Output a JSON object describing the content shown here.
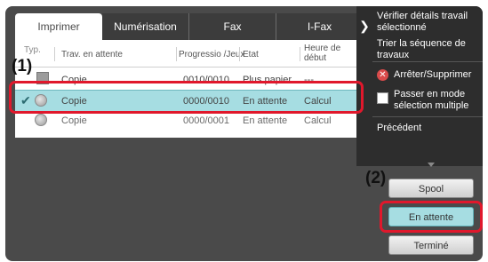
{
  "tabs": [
    {
      "label": "Imprimer",
      "active": true
    },
    {
      "label": "Numérisation",
      "active": false
    },
    {
      "label": "Fax",
      "active": false
    },
    {
      "label": "I-Fax",
      "active": false
    }
  ],
  "table": {
    "headers": {
      "type": "Typ.",
      "job": "Trav. en attente",
      "progress": "Progressio /Jeux",
      "status": "Etat",
      "start": "Heure de début"
    },
    "rows": [
      {
        "job": "Copie",
        "progress": "0010/0010",
        "status": "Plus papier",
        "start": "---"
      },
      {
        "job": "Copie",
        "progress": "0000/0010",
        "status": "En attente",
        "start": "Calcul"
      },
      {
        "job": "Copie",
        "progress": "0000/0001",
        "status": "En attente",
        "start": "Calcul"
      }
    ]
  },
  "side_menu": {
    "verify": "Vérifier détails travail sélectionné",
    "sort": "Trier la séquence de travaux",
    "stop": "Arrêter/Supprimer",
    "multi": "Passer en mode sélection multiple",
    "previous": "Précédent"
  },
  "buttons": {
    "spool": "Spool",
    "waiting": "En attente",
    "done": "Terminé"
  },
  "callouts": {
    "one": "(1)",
    "two": "(2)"
  },
  "colors": {
    "highlight": "#a6dde2",
    "annotation": "#e0182c",
    "stop_icon": "#d94b4b"
  }
}
